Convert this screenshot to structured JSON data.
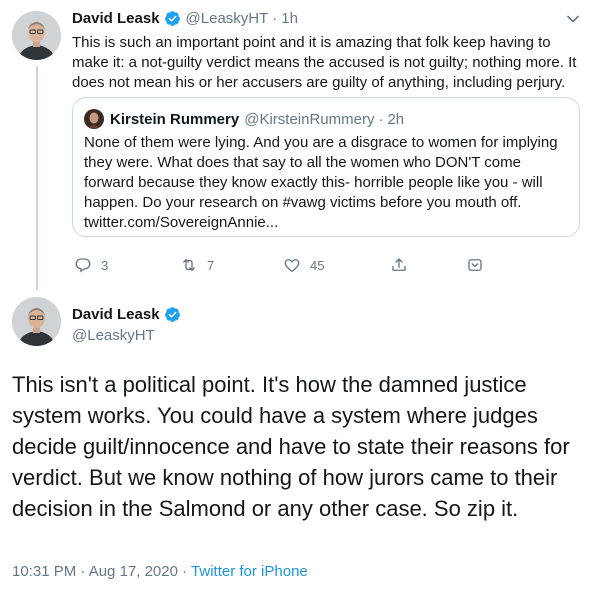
{
  "tweet1": {
    "name": "David Leask",
    "handle": "@LeaskyHT",
    "separator": "·",
    "time": "1h",
    "text": "This is such an important point and it is amazing that folk keep having to make it: a not-guilty verdict means the accused is not guilty; nothing more. It does not mean his or her accusers are guilty of anything, including perjury.",
    "quote": {
      "name": "Kirstein Rummery",
      "handle": "@KirsteinRummery",
      "separator": "·",
      "time": "2h",
      "text": "None of them were lying. And you are a disgrace to women for implying they were. What does that say to all the women who DON'T come forward because they know exactly this- horrible people like you - will happen. Do your research on #vawg victims before you mouth off. twitter.com/SovereignAnnie..."
    },
    "actions": {
      "reply_count": "3",
      "retweet_count": "7",
      "like_count": "45"
    }
  },
  "tweet2": {
    "name": "David Leask",
    "handle": "@LeaskyHT",
    "text": "This isn't a political point. It's how the damned justice system works. You could have a system where judges decide guilt/innocence and have to state their reasons for verdict. But we know nothing of how jurors came to their decision in the Salmond or any other case. So zip it.",
    "timestamp": "10:31 PM · Aug 17, 2020",
    "meta_separator": "·",
    "source": "Twitter for iPhone"
  },
  "colors": {
    "verified": "#1da1f2",
    "link": "#1b95e0",
    "secondary_text": "#657786",
    "border": "#ccd6dd"
  },
  "icons": [
    "verified-badge-icon",
    "chevron-down-icon",
    "reply-icon",
    "retweet-icon",
    "like-icon",
    "share-icon",
    "tip-icon"
  ]
}
